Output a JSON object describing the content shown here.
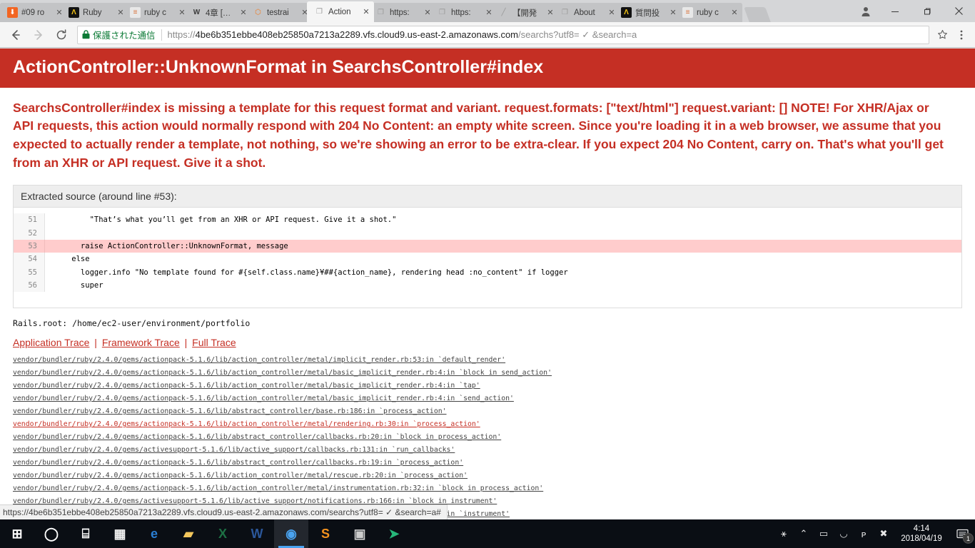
{
  "browser": {
    "tabs": [
      {
        "title": "#09 ro",
        "favicon": "download-icon",
        "favicon_glyph": "⬇",
        "favicon_class": "fav-dl",
        "active": false
      },
      {
        "title": "Ruby ",
        "favicon": "ruby-lang-icon",
        "favicon_glyph": "Λ",
        "favicon_class": "fav-dark",
        "active": false
      },
      {
        "title": "ruby c",
        "favicon": "stackoverflow-icon",
        "favicon_glyph": "≡",
        "favicon_class": "fav-so",
        "active": false
      },
      {
        "title": "4章 […",
        "favicon": "word-icon",
        "favicon_glyph": "W",
        "favicon_class": "fav-w",
        "active": false
      },
      {
        "title": "testrai",
        "favicon": "cube-icon",
        "favicon_glyph": "⬡",
        "favicon_class": "fav-cube",
        "active": false
      },
      {
        "title": "Action",
        "favicon": "page-icon",
        "favicon_glyph": "❐",
        "favicon_class": "fav-doc",
        "active": true
      },
      {
        "title": "https:",
        "favicon": "page-icon",
        "favicon_glyph": "❐",
        "favicon_class": "fav-doc",
        "active": false
      },
      {
        "title": "https:",
        "favicon": "page-icon",
        "favicon_glyph": "❐",
        "favicon_class": "fav-doc",
        "active": false
      },
      {
        "title": "【開発",
        "favicon": "slash-icon",
        "favicon_glyph": "╱",
        "favicon_class": "fav-slash",
        "active": false
      },
      {
        "title": "About",
        "favicon": "page-icon",
        "favicon_glyph": "❐",
        "favicon_class": "fav-doc",
        "active": false
      },
      {
        "title": "質問投",
        "favicon": "ruby-lang-icon",
        "favicon_glyph": "Λ",
        "favicon_class": "fav-dark",
        "active": false
      },
      {
        "title": "ruby c",
        "favicon": "stackoverflow-icon",
        "favicon_glyph": "≡",
        "favicon_class": "fav-so",
        "active": false
      }
    ],
    "new_tab_label": "",
    "window_controls": {
      "minimize": "—",
      "maximize": "❐",
      "close": "✕",
      "profile": "●"
    },
    "toolbar": {
      "back": "←",
      "forward": "→",
      "reload": "↻",
      "secure_label": "保護された通信",
      "lock_glyph": "■",
      "url_scheme": "https://",
      "url_host": "4be6b351ebbe408eb25850a7213a2289.vfs.cloud9.us-east-2.amazonaws.com",
      "url_path": "/searchs?utf8= ✓ &search=a",
      "star": "☆",
      "menu": "⋮"
    }
  },
  "page": {
    "error_title": "ActionController::UnknownFormat in SearchsController#index",
    "error_message": "SearchsController#index is missing a template for this request format and variant. request.formats: [\"text/html\"] request.variant: [] NOTE! For XHR/Ajax or API requests, this action would normally respond with 204 No Content: an empty white screen. Since you're loading it in a web browser, we assume that you expected to actually render a template, not nothing, so we're showing an error to be extra-clear. If you expect 204 No Content, carry on. That's what you'll get from an XHR or API request. Give it a shot.",
    "source": {
      "title": "Extracted source (around line #53):",
      "lines": [
        {
          "no": "51",
          "text": "        \"That’s what you’ll get from an XHR or API request. Give it a shot.\"",
          "highlight": false
        },
        {
          "no": "52",
          "text": "",
          "highlight": false
        },
        {
          "no": "53",
          "text": "      raise ActionController::UnknownFormat, message",
          "highlight": true
        },
        {
          "no": "54",
          "text": "    else",
          "highlight": false
        },
        {
          "no": "55",
          "text": "      logger.info \"No template found for #{self.class.name}¥##{action_name}, rendering head :no_content\" if logger",
          "highlight": false
        },
        {
          "no": "56",
          "text": "      super",
          "highlight": false
        }
      ]
    },
    "rails_root": "Rails.root: /home/ec2-user/environment/portfolio",
    "trace_tabs": [
      {
        "label": "Application Trace"
      },
      {
        "label": "Framework Trace"
      },
      {
        "label": "Full Trace"
      }
    ],
    "trace_separator": "|",
    "trace_rows": [
      "vendor/bundler/ruby/2.4.0/gems/actionpack-5.1.6/lib/action_controller/metal/implicit_render.rb:53:in `default_render'",
      "vendor/bundler/ruby/2.4.0/gems/actionpack-5.1.6/lib/action_controller/metal/basic_implicit_render.rb:4:in `block in send_action'",
      "vendor/bundler/ruby/2.4.0/gems/actionpack-5.1.6/lib/action_controller/metal/basic_implicit_render.rb:4:in `tap'",
      "vendor/bundler/ruby/2.4.0/gems/actionpack-5.1.6/lib/action_controller/metal/basic_implicit_render.rb:4:in `send_action'",
      "vendor/bundler/ruby/2.4.0/gems/actionpack-5.1.6/lib/abstract_controller/base.rb:186:in `process_action'",
      "vendor/bundler/ruby/2.4.0/gems/actionpack-5.1.6/lib/action_controller/metal/rendering.rb:30:in `process_action'",
      "vendor/bundler/ruby/2.4.0/gems/actionpack-5.1.6/lib/abstract_controller/callbacks.rb:20:in `block in process_action'",
      "vendor/bundler/ruby/2.4.0/gems/activesupport-5.1.6/lib/active_support/callbacks.rb:131:in `run_callbacks'",
      "vendor/bundler/ruby/2.4.0/gems/actionpack-5.1.6/lib/abstract_controller/callbacks.rb:19:in `process_action'",
      "vendor/bundler/ruby/2.4.0/gems/actionpack-5.1.6/lib/action_controller/metal/rescue.rb:20:in `process_action'",
      "vendor/bundler/ruby/2.4.0/gems/actionpack-5.1.6/lib/action_controller/metal/instrumentation.rb:32:in `block in process_action'",
      "vendor/bundler/ruby/2.4.0/gems/activesupport-5.1.6/lib/active_support/notifications.rb:166:in `block in instrument'",
      "vendor/bundler/ruby/2.4.0/gems/activesupport-5.1.6/lib/active_support/notifications/instrumenter.rb:21:in `instrument'"
    ],
    "status_bubble_url": "https://4be6b351ebbe408eb25850a7213a2289.vfs.cloud9.us-east-2.amazonaws.com/searchs?utf8= ✓ &search=a#"
  },
  "taskbar": {
    "items": [
      {
        "name": "start-button",
        "glyph": "⊞",
        "color": "#ffffff",
        "active": false
      },
      {
        "name": "cortana-button",
        "glyph": "◯",
        "color": "#ffffff",
        "active": false
      },
      {
        "name": "task-view-button",
        "glyph": "⌸",
        "color": "#ffffff",
        "active": false
      },
      {
        "name": "microsoft-store-icon",
        "glyph": "▦",
        "color": "#f2f2f2",
        "active": false
      },
      {
        "name": "edge-browser-icon",
        "glyph": "e",
        "color": "#2a7fd4",
        "active": false
      },
      {
        "name": "file-explorer-icon",
        "glyph": "▰",
        "color": "#f2c65c",
        "active": false
      },
      {
        "name": "excel-icon",
        "glyph": "X",
        "color": "#1d7044",
        "active": false
      },
      {
        "name": "word-icon",
        "glyph": "W",
        "color": "#2b579a",
        "active": false
      },
      {
        "name": "chrome-icon",
        "glyph": "◉",
        "color": "#4aa3f0",
        "active": true
      },
      {
        "name": "sublime-text-icon",
        "glyph": "S",
        "color": "#f3921e",
        "active": false
      },
      {
        "name": "command-prompt-icon",
        "glyph": "▣",
        "color": "#cccccc",
        "active": false
      },
      {
        "name": "telegram-icon",
        "glyph": "➤",
        "color": "#27b77a",
        "active": false
      }
    ],
    "tray": [
      {
        "name": "people-icon",
        "glyph": "⚹"
      },
      {
        "name": "show-hidden-icons-chevron",
        "glyph": "⌃"
      },
      {
        "name": "battery-icon",
        "glyph": "▭"
      },
      {
        "name": "wifi-icon",
        "glyph": "◡"
      },
      {
        "name": "volume-icon",
        "glyph": "ᴘ"
      },
      {
        "name": "error-status-icon",
        "glyph": "✖"
      }
    ],
    "clock_time": "4:14",
    "clock_date": "2018/04/19",
    "notification_count": "1"
  },
  "colors": {
    "error_red": "#c52f24",
    "highlight_pink": "#ffcccc",
    "taskbar_bg": "#0a0e14",
    "accent_blue": "#4aa3f0"
  }
}
